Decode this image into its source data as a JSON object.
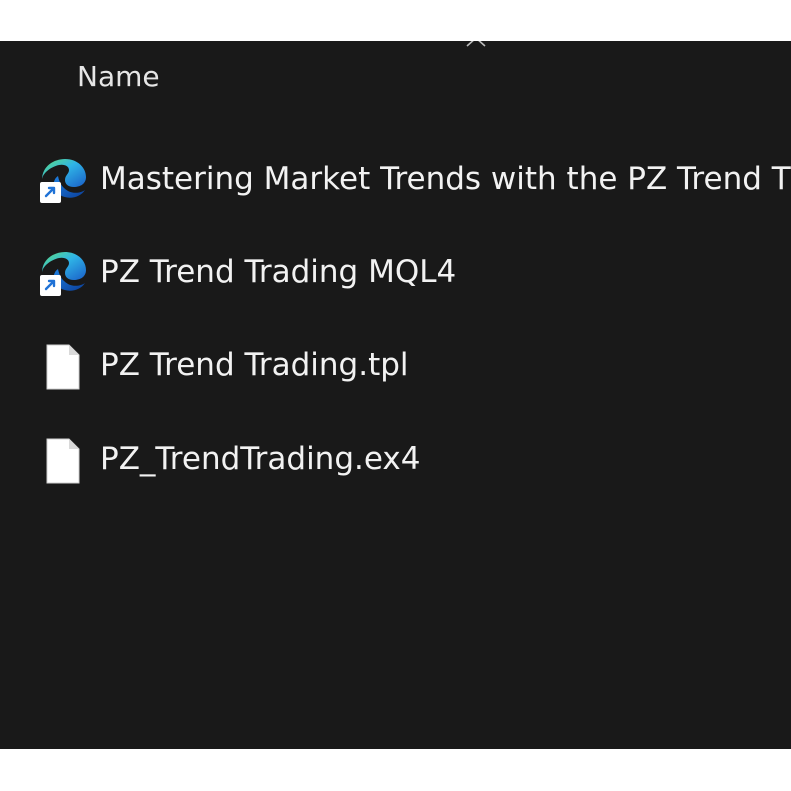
{
  "header": {
    "name_column": "Name"
  },
  "files": [
    {
      "name": "Mastering Market Trends with the PZ Trend T",
      "icon": "edge-shortcut-icon"
    },
    {
      "name": "PZ Trend Trading MQL4",
      "icon": "edge-shortcut-icon"
    },
    {
      "name": "PZ Trend Trading.tpl",
      "icon": "blank-file-icon"
    },
    {
      "name": "PZ_TrendTrading.ex4",
      "icon": "blank-file-icon"
    }
  ],
  "colors": {
    "background": "#191919",
    "text": "#f2f2f2",
    "header_text": "#e6e6e6"
  }
}
